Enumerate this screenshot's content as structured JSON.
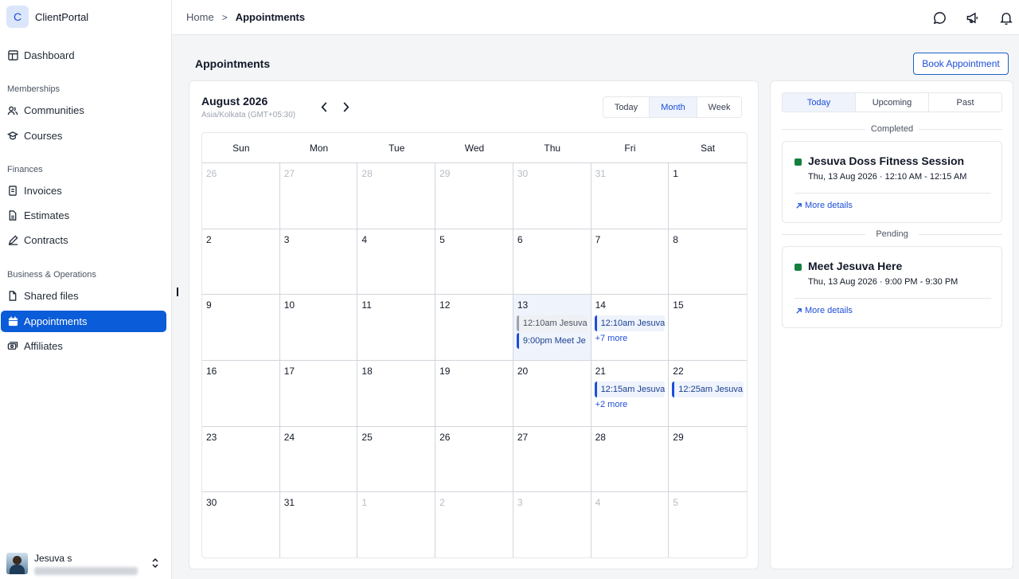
{
  "brand": {
    "logo_letter": "C",
    "name": "ClientPortal"
  },
  "sidebar": {
    "dashboard": "Dashboard",
    "sections": {
      "memberships": "Memberships",
      "finances": "Finances",
      "business": "Business & Operations"
    },
    "items": {
      "communities": "Communities",
      "courses": "Courses",
      "invoices": "Invoices",
      "estimates": "Estimates",
      "contracts": "Contracts",
      "shared_files": "Shared files",
      "appointments": "Appointments",
      "affiliates": "Affiliates"
    },
    "user": {
      "name": "Jesuva s"
    }
  },
  "header": {
    "breadcrumb_home": "Home",
    "breadcrumb_sep": ">",
    "breadcrumb_current": "Appointments",
    "icons": [
      "chat-icon",
      "megaphone-icon",
      "bell-icon"
    ]
  },
  "page": {
    "title": "Appointments",
    "book_button": "Book Appointment"
  },
  "calendar": {
    "month_label": "August 2026",
    "timezone": "Asia/Kolkata (GMT+05:30)",
    "views": {
      "today": "Today",
      "month": "Month",
      "week": "Week"
    },
    "active_view": "Month",
    "weekdays": [
      "Sun",
      "Mon",
      "Tue",
      "Wed",
      "Thu",
      "Fri",
      "Sat"
    ],
    "weeks": [
      [
        {
          "n": "26",
          "muted": true
        },
        {
          "n": "27",
          "muted": true
        },
        {
          "n": "28",
          "muted": true
        },
        {
          "n": "29",
          "muted": true
        },
        {
          "n": "30",
          "muted": true
        },
        {
          "n": "31",
          "muted": true
        },
        {
          "n": "1"
        }
      ],
      [
        {
          "n": "2"
        },
        {
          "n": "3"
        },
        {
          "n": "4"
        },
        {
          "n": "5"
        },
        {
          "n": "6"
        },
        {
          "n": "7"
        },
        {
          "n": "8"
        }
      ],
      [
        {
          "n": "9"
        },
        {
          "n": "10"
        },
        {
          "n": "11"
        },
        {
          "n": "12"
        },
        {
          "n": "13",
          "today": true,
          "events": [
            {
              "label": "12:10am Jesuva",
              "past": true
            },
            {
              "label": "9:00pm Meet Je"
            }
          ]
        },
        {
          "n": "14",
          "events": [
            {
              "label": "12:10am Jesuva"
            }
          ],
          "more": "+7 more"
        },
        {
          "n": "15"
        }
      ],
      [
        {
          "n": "16"
        },
        {
          "n": "17"
        },
        {
          "n": "18"
        },
        {
          "n": "19"
        },
        {
          "n": "20"
        },
        {
          "n": "21",
          "events": [
            {
              "label": "12:15am Jesuva"
            }
          ],
          "more": "+2 more"
        },
        {
          "n": "22",
          "events": [
            {
              "label": "12:25am Jesuva"
            }
          ]
        }
      ],
      [
        {
          "n": "23"
        },
        {
          "n": "24"
        },
        {
          "n": "25"
        },
        {
          "n": "26"
        },
        {
          "n": "27"
        },
        {
          "n": "28"
        },
        {
          "n": "29"
        }
      ],
      [
        {
          "n": "30"
        },
        {
          "n": "31"
        },
        {
          "n": "1",
          "muted": true
        },
        {
          "n": "2",
          "muted": true
        },
        {
          "n": "3",
          "muted": true
        },
        {
          "n": "4",
          "muted": true
        },
        {
          "n": "5",
          "muted": true
        }
      ]
    ]
  },
  "panel": {
    "tabs": {
      "today": "Today",
      "upcoming": "Upcoming",
      "past": "Past"
    },
    "active_tab": "Today",
    "completed_label": "Completed",
    "pending_label": "Pending",
    "completed": {
      "title": "Jesuva Doss Fitness Session",
      "time": "Thu, 13 Aug 2026 · 12:10 AM - 12:15 AM",
      "link": "More details"
    },
    "pending": {
      "title": "Meet Jesuva Here",
      "time": "Thu, 13 Aug 2026 · 9:00 PM - 9:30 PM",
      "link": "More details"
    }
  },
  "colors": {
    "accent": "#0b5cd8",
    "status_green": "#15803d"
  }
}
